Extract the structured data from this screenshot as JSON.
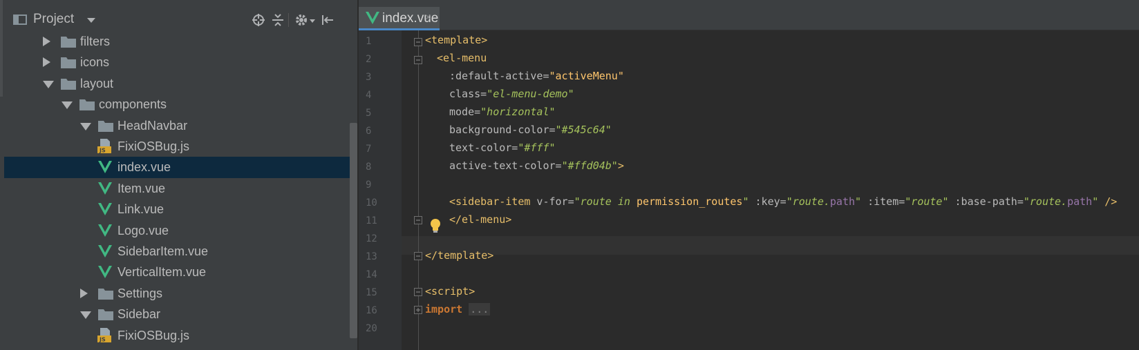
{
  "project": {
    "title": "Project",
    "tree": [
      {
        "label": "filters",
        "type": "folder",
        "state": "collapsed",
        "depth": 0
      },
      {
        "label": "icons",
        "type": "folder",
        "state": "collapsed",
        "depth": 0
      },
      {
        "label": "layout",
        "type": "folder",
        "state": "expanded",
        "depth": 0
      },
      {
        "label": "components",
        "type": "folder",
        "state": "expanded",
        "depth": 1
      },
      {
        "label": "HeadNavbar",
        "type": "folder",
        "state": "expanded",
        "depth": 2
      },
      {
        "label": "FixiOSBug.js",
        "type": "js",
        "depth": 3
      },
      {
        "label": "index.vue",
        "type": "vue",
        "depth": 3,
        "selected": true
      },
      {
        "label": "Item.vue",
        "type": "vue",
        "depth": 3
      },
      {
        "label": "Link.vue",
        "type": "vue",
        "depth": 3
      },
      {
        "label": "Logo.vue",
        "type": "vue",
        "depth": 3
      },
      {
        "label": "SidebarItem.vue",
        "type": "vue",
        "depth": 3
      },
      {
        "label": "VerticalItem.vue",
        "type": "vue",
        "depth": 3
      },
      {
        "label": "Settings",
        "type": "folder",
        "state": "collapsed",
        "depth": 2
      },
      {
        "label": "Sidebar",
        "type": "folder",
        "state": "expanded",
        "depth": 2
      },
      {
        "label": "FixiOSBug.js",
        "type": "js",
        "depth": 3
      }
    ]
  },
  "editor": {
    "tab_label": "index.vue",
    "tab_close": "×",
    "line_numbers": [
      "1",
      "2",
      "3",
      "4",
      "5",
      "6",
      "7",
      "8",
      "9",
      "10",
      "11",
      "12",
      "13",
      "14",
      "15",
      "16",
      "20"
    ],
    "lines": {
      "l1_open": "<template>",
      "l2_tag": "<el-menu",
      "l3_attr": ":default-active=",
      "l3_val": "\"activeMenu\"",
      "l4_attr": "class=",
      "l4_val": "\"el-menu-demo\"",
      "l5_attr": "mode=",
      "l5_val": "\"horizontal\"",
      "l6_attr": "background-color=",
      "l6_val": "\"#545c64\"",
      "l7_attr": "text-color=",
      "l7_val": "\"#fff\"",
      "l8_attr": "active-text-color=",
      "l8_val": "\"#ffd04b\"",
      "l8_close": ">",
      "l10_tag": "<sidebar-item",
      "l10_vfor": " v-for=",
      "l10_q1": "\"route in ",
      "l10_perm": "permission_routes",
      "l10_q1e": "\"",
      "l10_key": " :key=",
      "l10_q2": "\"route.",
      "l10_path1": "path",
      "l10_q2e": "\"",
      "l10_item": " :item=",
      "l10_q3": "\"route\"",
      "l10_base": " :base-path=",
      "l10_q4": "\"route.",
      "l10_path2": "path",
      "l10_q4e": "\"",
      "l10_end": " />",
      "l11_close": "</el-menu>",
      "l13_close": "</template>",
      "l15_open": "<script>",
      "l16_kw": "import",
      "l16_fold": "..."
    }
  },
  "colors": {
    "panel_bg": "#3c3f41",
    "editor_bg": "#2b2b2b",
    "selected_row": "#0d293e",
    "vue_green": "#41b883",
    "tag": "#e8bf6a",
    "string": "#a5c25c",
    "keyword": "#cc7832"
  }
}
